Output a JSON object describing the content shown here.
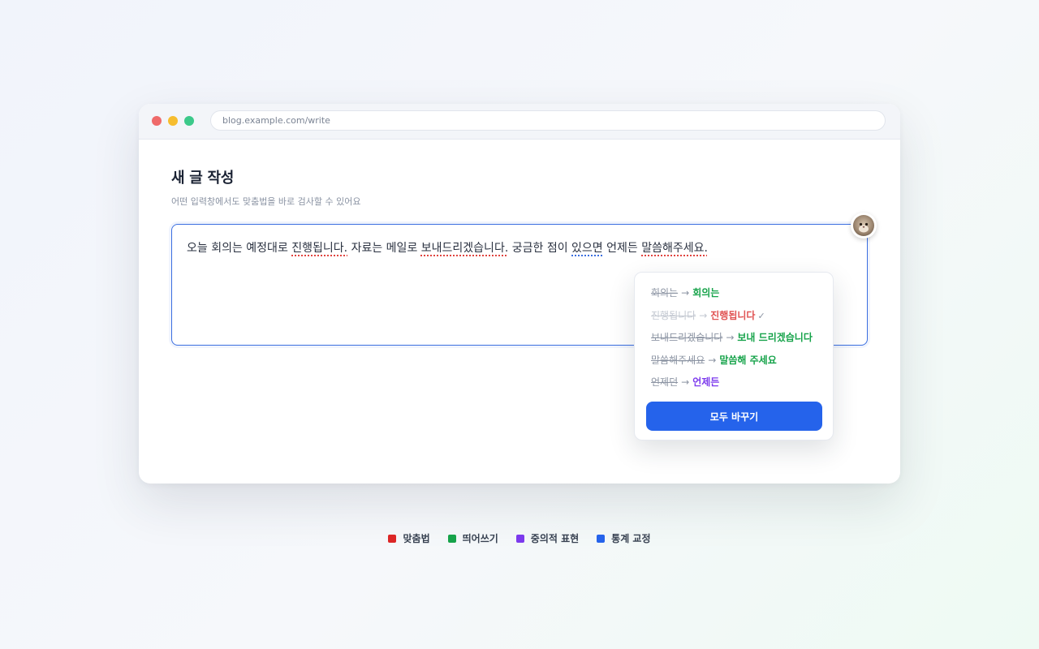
{
  "browser": {
    "url": "blog.example.com/write"
  },
  "page": {
    "title": "새 글 작성",
    "subtitle": "어떤 입력창에서도 맞춤법을 바로 검사할 수 있어요"
  },
  "editor": {
    "segments": [
      {
        "text": "오늘 회의는 예정대로 ",
        "error": ""
      },
      {
        "text": "진행됩니다.",
        "error": "red"
      },
      {
        "text": " 자료는 메일로 ",
        "error": ""
      },
      {
        "text": "보내드리겠습니다.",
        "error": "red"
      },
      {
        "text": " 궁금한 점이 ",
        "error": ""
      },
      {
        "text": "있으면",
        "error": "blue"
      },
      {
        "text": " 언제든 ",
        "error": ""
      },
      {
        "text": "말씀해주세요.",
        "error": "red"
      }
    ]
  },
  "suggestions": {
    "items": [
      {
        "original": "회의는",
        "fixed": "회의는",
        "color": "#16a34a",
        "applied": false
      },
      {
        "original": "진행됩니다",
        "fixed": "진행됩니다",
        "color": "#e05252",
        "applied": true
      },
      {
        "original": "보내드리겠습니다",
        "fixed": "보내 드리겠습니다",
        "color": "#16a34a",
        "applied": false
      },
      {
        "original": "말씀해주세요",
        "fixed": "말씀해 주세요",
        "color": "#16a34a",
        "applied": false
      },
      {
        "original": "언제던",
        "fixed": "언제든",
        "color": "#7c3aed",
        "applied": false
      }
    ],
    "arrow": "→",
    "check_mark": "✓",
    "replace_all_label": "모두 바꾸기"
  },
  "legend": [
    {
      "label": "맞춤법",
      "color": "#dc2626"
    },
    {
      "label": "띄어쓰기",
      "color": "#16a34a"
    },
    {
      "label": "중의적 표현",
      "color": "#7c3aed"
    },
    {
      "label": "통계 교정",
      "color": "#2563eb"
    }
  ]
}
